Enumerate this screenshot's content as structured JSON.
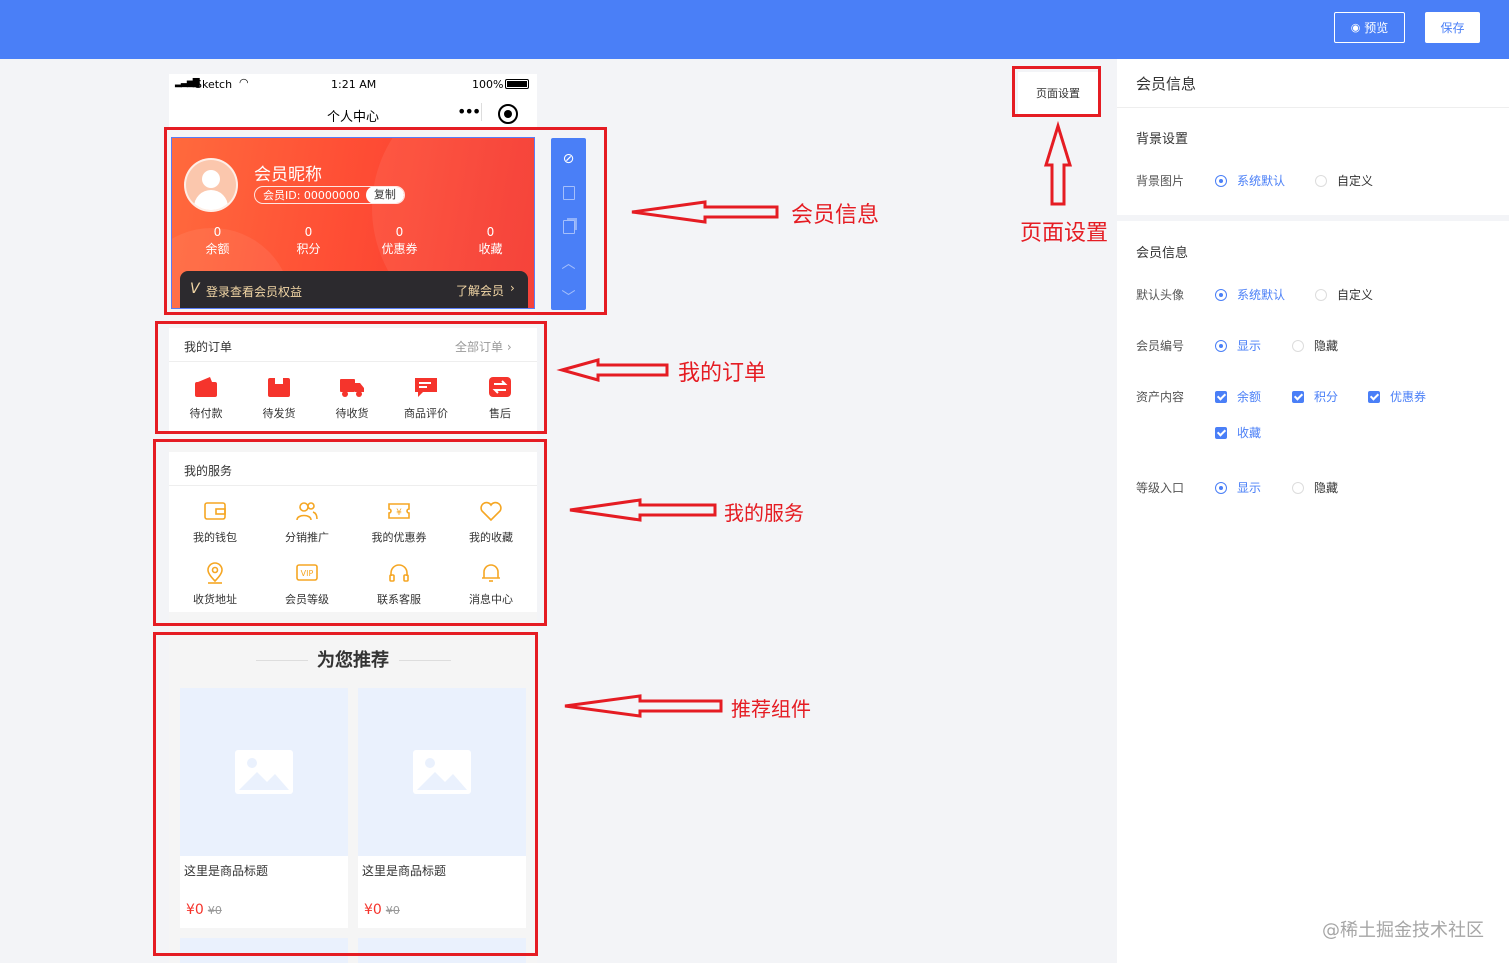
{
  "topbar": {
    "preview_label": "预览",
    "save_label": "保存",
    "color": "#4a7ff7"
  },
  "phone": {
    "status": {
      "carrier": "Sketch",
      "time": "1:21 AM",
      "battery": "100%"
    },
    "nav_title": "个人中心",
    "member": {
      "nickname": "会员昵称",
      "member_id": "会员ID: 00000000",
      "copy_label": "复制",
      "stats": [
        {
          "value": "0",
          "label": "余额"
        },
        {
          "value": "0",
          "label": "积分"
        },
        {
          "value": "0",
          "label": "优惠券"
        },
        {
          "value": "0",
          "label": "收藏"
        }
      ],
      "login_text": "登录查看会员权益",
      "vip_mark": "V",
      "learn_more": "了解会员"
    },
    "orders": {
      "title": "我的订单",
      "all_link": "全部订单",
      "items": [
        {
          "label": "待付款",
          "icon": "wallet-icon"
        },
        {
          "label": "待发货",
          "icon": "package-icon"
        },
        {
          "label": "待收货",
          "icon": "truck-icon"
        },
        {
          "label": "商品评价",
          "icon": "comment-icon"
        },
        {
          "label": "售后",
          "icon": "exchange-icon"
        }
      ]
    },
    "services": {
      "title": "我的服务",
      "items": [
        {
          "label": "我的钱包",
          "icon": "wallet-icon"
        },
        {
          "label": "分销推广",
          "icon": "users-icon"
        },
        {
          "label": "我的优惠券",
          "icon": "coupon-icon"
        },
        {
          "label": "我的收藏",
          "icon": "heart-icon"
        },
        {
          "label": "收货地址",
          "icon": "location-icon"
        },
        {
          "label": "会员等级",
          "icon": "vip-icon"
        },
        {
          "label": "联系客服",
          "icon": "headset-icon"
        },
        {
          "label": "消息中心",
          "icon": "bell-icon"
        }
      ]
    },
    "recommend": {
      "title": "为您推荐",
      "products": [
        {
          "title": "这里是商品标题",
          "price": "¥0",
          "original_price": "¥0"
        },
        {
          "title": "这里是商品标题",
          "price": "¥0",
          "original_price": "¥0"
        }
      ]
    }
  },
  "page_setting_button": "页面设置",
  "annotations": {
    "member": "会员信息",
    "page_setting": "页面设置",
    "orders": "我的订单",
    "services": "我的服务",
    "recommend": "推荐组件",
    "color": "#e51c23"
  },
  "right_panel": {
    "title": "会员信息",
    "bg_section": "背景设置",
    "bg_image_label": "背景图片",
    "bg_options": [
      "系统默认",
      "自定义"
    ],
    "member_section": "会员信息",
    "avatar_label": "默认头像",
    "avatar_options": [
      "系统默认",
      "自定义"
    ],
    "number_label": "会员编号",
    "number_options": [
      "显示",
      "隐藏"
    ],
    "assets_label": "资产内容",
    "assets_options": [
      "余额",
      "积分",
      "优惠券",
      "收藏"
    ],
    "level_label": "等级入口",
    "level_options": [
      "显示",
      "隐藏"
    ]
  },
  "watermark": "@稀土掘金技术社区"
}
